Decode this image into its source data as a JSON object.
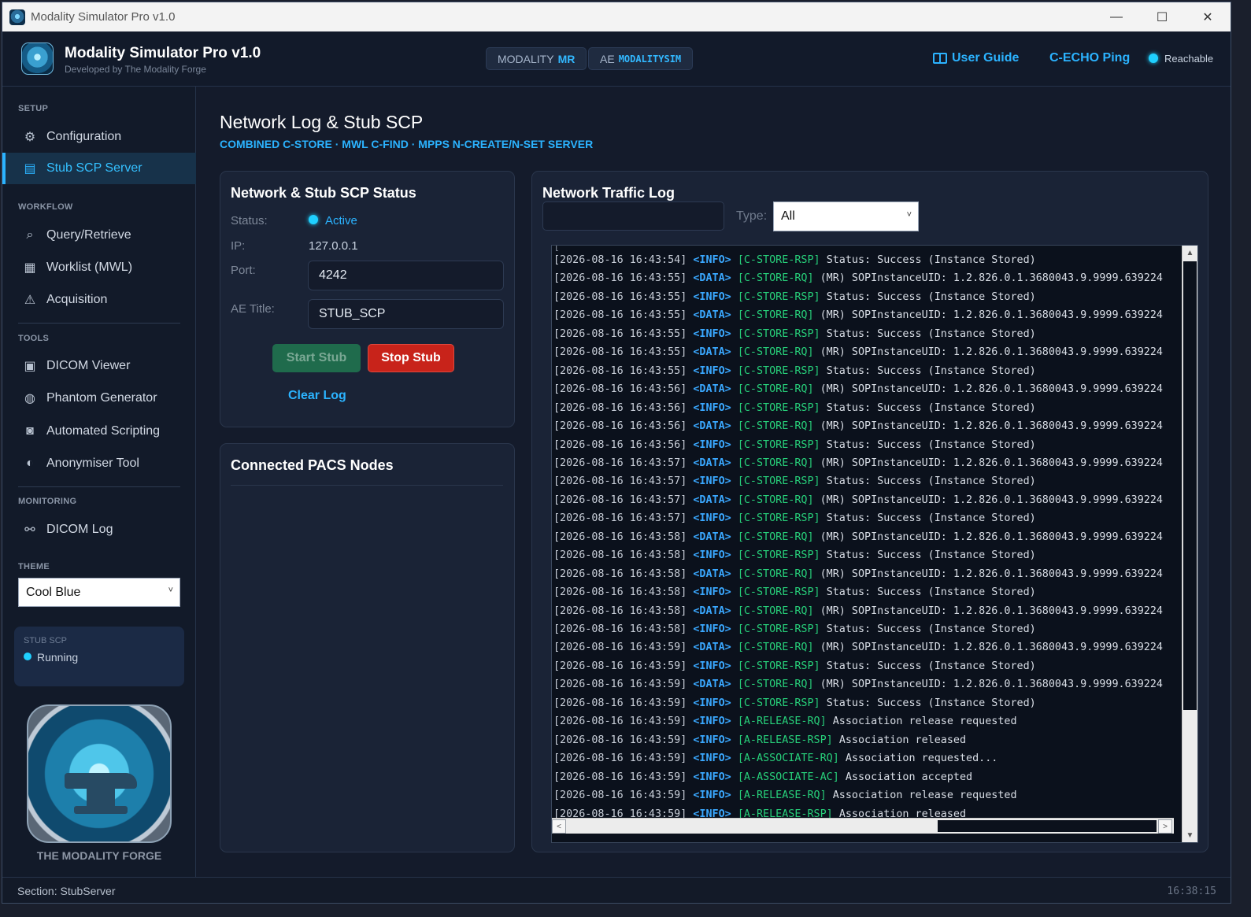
{
  "window": {
    "title": "Modality Simulator Pro v1.0",
    "controls": {
      "minimize": "—",
      "maximize": "☐",
      "close": "✕"
    }
  },
  "header": {
    "app_name": "Modality Simulator Pro v1.0",
    "developer": "Developed by The Modality Forge",
    "modality_label": "MODALITY",
    "modality_value": "MR",
    "ae_label": "AE",
    "ae_value": "MODALITYSIM",
    "user_guide": "User Guide",
    "echo": "C-ECHO Ping",
    "reachable": "Reachable"
  },
  "sidebar": {
    "sections": {
      "setup": "SETUP",
      "workflow": "WORKFLOW",
      "tools": "TOOLS",
      "monitoring": "MONITORING",
      "theme": "THEME"
    },
    "items": [
      {
        "label": "Configuration",
        "icon": "gear-icon"
      },
      {
        "label": "Stub SCP Server",
        "icon": "server-icon"
      },
      {
        "label": "Query/Retrieve",
        "icon": "search-icon"
      },
      {
        "label": "Worklist (MWL)",
        "icon": "list-icon"
      },
      {
        "label": "Acquisition",
        "icon": "scanner-icon"
      },
      {
        "label": "DICOM Viewer",
        "icon": "image-icon"
      },
      {
        "label": "Phantom Generator",
        "icon": "phantom-icon"
      },
      {
        "label": "Automated Scripting",
        "icon": "robot-icon"
      },
      {
        "label": "Anonymiser Tool",
        "icon": "shield-icon"
      },
      {
        "label": "DICOM Log",
        "icon": "log-icon"
      }
    ],
    "theme_value": "Cool Blue",
    "stub_card": {
      "label": "STUB SCP",
      "status": "Running"
    },
    "forge_text": "THE MODALITY FORGE"
  },
  "main": {
    "title": "Network Log & Stub SCP",
    "subtitle": "COMBINED C-STORE · MWL C-FIND · MPPS N-CREATE/N-SET SERVER",
    "status_card": {
      "title": "Network & Stub SCP Status",
      "status_label": "Status:",
      "status_value": "Active",
      "ip_label": "IP:",
      "ip_value": "127.0.0.1",
      "port_label": "Port:",
      "port_value": "4242",
      "ae_label": "AE Title:",
      "ae_value": "STUB_SCP",
      "start": "Start Stub",
      "stop": "Stop Stub",
      "clear": "Clear Log"
    },
    "pacs_card": {
      "title": "Connected PACS Nodes"
    },
    "log_card": {
      "title": "Network Traffic Log",
      "search_value": "",
      "type_label": "Type:",
      "type_value": "All"
    }
  },
  "log": [
    {
      "ts": "[2026-08-16 16:43:54]",
      "lvl": "<INFO>",
      "cmd": "[C-STORE-RSP]",
      "msg": "Status: Success (Instance Stored)"
    },
    {
      "ts": "[2026-08-16 16:43:55]",
      "lvl": "<DATA>",
      "cmd": "[C-STORE-RQ]",
      "msg": "(MR) SOPInstanceUID: 1.2.826.0.1.3680043.9.9999.639224"
    },
    {
      "ts": "[2026-08-16 16:43:55]",
      "lvl": "<INFO>",
      "cmd": "[C-STORE-RSP]",
      "msg": "Status: Success (Instance Stored)"
    },
    {
      "ts": "[2026-08-16 16:43:55]",
      "lvl": "<DATA>",
      "cmd": "[C-STORE-RQ]",
      "msg": "(MR) SOPInstanceUID: 1.2.826.0.1.3680043.9.9999.639224"
    },
    {
      "ts": "[2026-08-16 16:43:55]",
      "lvl": "<INFO>",
      "cmd": "[C-STORE-RSP]",
      "msg": "Status: Success (Instance Stored)"
    },
    {
      "ts": "[2026-08-16 16:43:55]",
      "lvl": "<DATA>",
      "cmd": "[C-STORE-RQ]",
      "msg": "(MR) SOPInstanceUID: 1.2.826.0.1.3680043.9.9999.639224"
    },
    {
      "ts": "[2026-08-16 16:43:55]",
      "lvl": "<INFO>",
      "cmd": "[C-STORE-RSP]",
      "msg": "Status: Success (Instance Stored)"
    },
    {
      "ts": "[2026-08-16 16:43:56]",
      "lvl": "<DATA>",
      "cmd": "[C-STORE-RQ]",
      "msg": "(MR) SOPInstanceUID: 1.2.826.0.1.3680043.9.9999.639224"
    },
    {
      "ts": "[2026-08-16 16:43:56]",
      "lvl": "<INFO>",
      "cmd": "[C-STORE-RSP]",
      "msg": "Status: Success (Instance Stored)"
    },
    {
      "ts": "[2026-08-16 16:43:56]",
      "lvl": "<DATA>",
      "cmd": "[C-STORE-RQ]",
      "msg": "(MR) SOPInstanceUID: 1.2.826.0.1.3680043.9.9999.639224"
    },
    {
      "ts": "[2026-08-16 16:43:56]",
      "lvl": "<INFO>",
      "cmd": "[C-STORE-RSP]",
      "msg": "Status: Success (Instance Stored)"
    },
    {
      "ts": "[2026-08-16 16:43:57]",
      "lvl": "<DATA>",
      "cmd": "[C-STORE-RQ]",
      "msg": "(MR) SOPInstanceUID: 1.2.826.0.1.3680043.9.9999.639224"
    },
    {
      "ts": "[2026-08-16 16:43:57]",
      "lvl": "<INFO>",
      "cmd": "[C-STORE-RSP]",
      "msg": "Status: Success (Instance Stored)"
    },
    {
      "ts": "[2026-08-16 16:43:57]",
      "lvl": "<DATA>",
      "cmd": "[C-STORE-RQ]",
      "msg": "(MR) SOPInstanceUID: 1.2.826.0.1.3680043.9.9999.639224"
    },
    {
      "ts": "[2026-08-16 16:43:57]",
      "lvl": "<INFO>",
      "cmd": "[C-STORE-RSP]",
      "msg": "Status: Success (Instance Stored)"
    },
    {
      "ts": "[2026-08-16 16:43:58]",
      "lvl": "<DATA>",
      "cmd": "[C-STORE-RQ]",
      "msg": "(MR) SOPInstanceUID: 1.2.826.0.1.3680043.9.9999.639224"
    },
    {
      "ts": "[2026-08-16 16:43:58]",
      "lvl": "<INFO>",
      "cmd": "[C-STORE-RSP]",
      "msg": "Status: Success (Instance Stored)"
    },
    {
      "ts": "[2026-08-16 16:43:58]",
      "lvl": "<DATA>",
      "cmd": "[C-STORE-RQ]",
      "msg": "(MR) SOPInstanceUID: 1.2.826.0.1.3680043.9.9999.639224"
    },
    {
      "ts": "[2026-08-16 16:43:58]",
      "lvl": "<INFO>",
      "cmd": "[C-STORE-RSP]",
      "msg": "Status: Success (Instance Stored)"
    },
    {
      "ts": "[2026-08-16 16:43:58]",
      "lvl": "<DATA>",
      "cmd": "[C-STORE-RQ]",
      "msg": "(MR) SOPInstanceUID: 1.2.826.0.1.3680043.9.9999.639224"
    },
    {
      "ts": "[2026-08-16 16:43:58]",
      "lvl": "<INFO>",
      "cmd": "[C-STORE-RSP]",
      "msg": "Status: Success (Instance Stored)"
    },
    {
      "ts": "[2026-08-16 16:43:59]",
      "lvl": "<DATA>",
      "cmd": "[C-STORE-RQ]",
      "msg": "(MR) SOPInstanceUID: 1.2.826.0.1.3680043.9.9999.639224"
    },
    {
      "ts": "[2026-08-16 16:43:59]",
      "lvl": "<INFO>",
      "cmd": "[C-STORE-RSP]",
      "msg": "Status: Success (Instance Stored)"
    },
    {
      "ts": "[2026-08-16 16:43:59]",
      "lvl": "<DATA>",
      "cmd": "[C-STORE-RQ]",
      "msg": "(MR) SOPInstanceUID: 1.2.826.0.1.3680043.9.9999.639224"
    },
    {
      "ts": "[2026-08-16 16:43:59]",
      "lvl": "<INFO>",
      "cmd": "[C-STORE-RSP]",
      "msg": "Status: Success (Instance Stored)"
    },
    {
      "ts": "[2026-08-16 16:43:59]",
      "lvl": "<INFO>",
      "cmd": "[A-RELEASE-RQ]",
      "msg": "Association release requested"
    },
    {
      "ts": "[2026-08-16 16:43:59]",
      "lvl": "<INFO>",
      "cmd": "[A-RELEASE-RSP]",
      "msg": "Association released"
    },
    {
      "ts": "[2026-08-16 16:43:59]",
      "lvl": "<INFO>",
      "cmd": "[A-ASSOCIATE-RQ]",
      "msg": "Association requested..."
    },
    {
      "ts": "[2026-08-16 16:43:59]",
      "lvl": "<INFO>",
      "cmd": "[A-ASSOCIATE-AC]",
      "msg": "Association accepted"
    },
    {
      "ts": "[2026-08-16 16:43:59]",
      "lvl": "<INFO>",
      "cmd": "[A-RELEASE-RQ]",
      "msg": "Association release requested"
    },
    {
      "ts": "[2026-08-16 16:43:59]",
      "lvl": "<INFO>",
      "cmd": "[A-RELEASE-RSP]",
      "msg": "Association released"
    }
  ],
  "statusbar": {
    "section": "Section: StubServer",
    "clock": "16:38:15"
  },
  "colors": {
    "accent": "#2bb3ff",
    "background": "#141b2b",
    "start_button": "#1f6b4c",
    "stop_button": "#c8231a",
    "log_cmd": "#27d07a"
  }
}
